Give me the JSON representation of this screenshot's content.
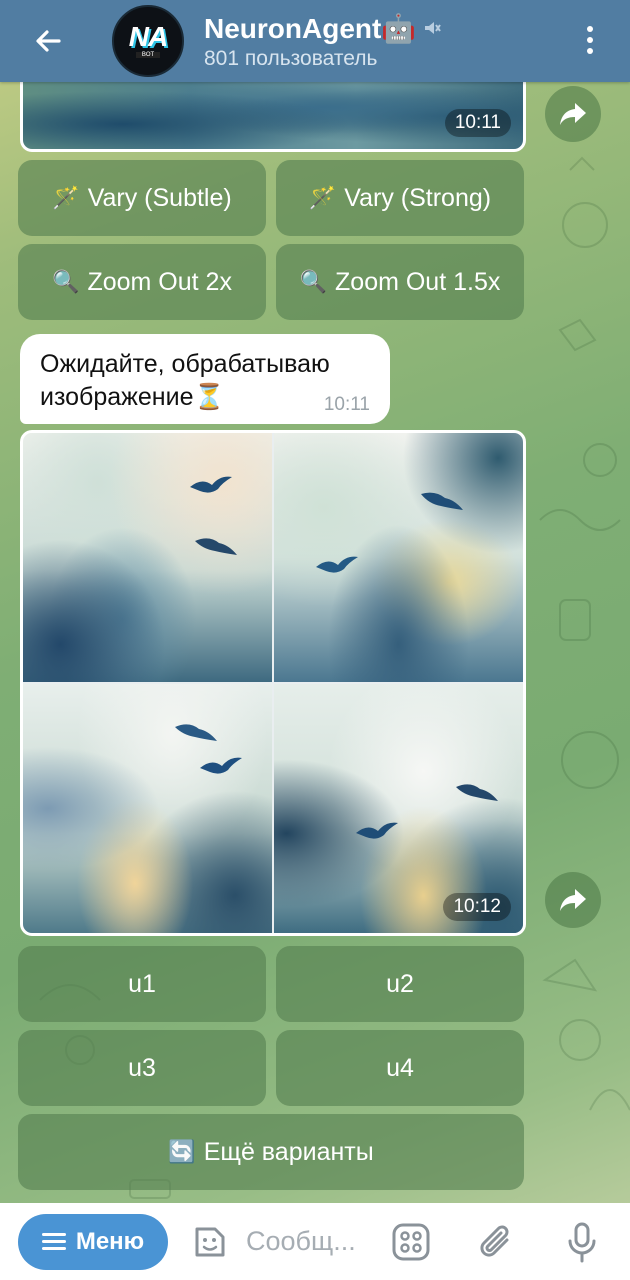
{
  "header": {
    "title": "NeuronAgent🤖",
    "subtitle": "801 пользователь",
    "avatar_logo": "NA",
    "avatar_sub": "BOT"
  },
  "messages": {
    "photo_top_time": "10:11",
    "buttons_top": [
      {
        "icon": "🪄",
        "label": "Vary (Subtle)"
      },
      {
        "icon": "🪄",
        "label": "Vary (Strong)"
      },
      {
        "icon": "🔍",
        "label": "Zoom Out 2x"
      },
      {
        "icon": "🔍",
        "label": "Zoom Out 1.5x"
      }
    ],
    "wait_text_line1": "Ожидайте, обрабатываю",
    "wait_text_line2": "изображение⏳",
    "wait_time": "10:11",
    "photo_grid_time": "10:12",
    "buttons_bottom": [
      {
        "label": "u1"
      },
      {
        "label": "u2"
      },
      {
        "label": "u3"
      },
      {
        "label": "u4"
      }
    ],
    "more_variants": {
      "icon": "🔄",
      "label": "Ещё варианты"
    }
  },
  "input": {
    "menu_label": "Меню",
    "placeholder": "Сообщ..."
  },
  "colors": {
    "header": "#517da2",
    "menu_button": "#4a94d4",
    "keyboard_button": "#558050"
  }
}
